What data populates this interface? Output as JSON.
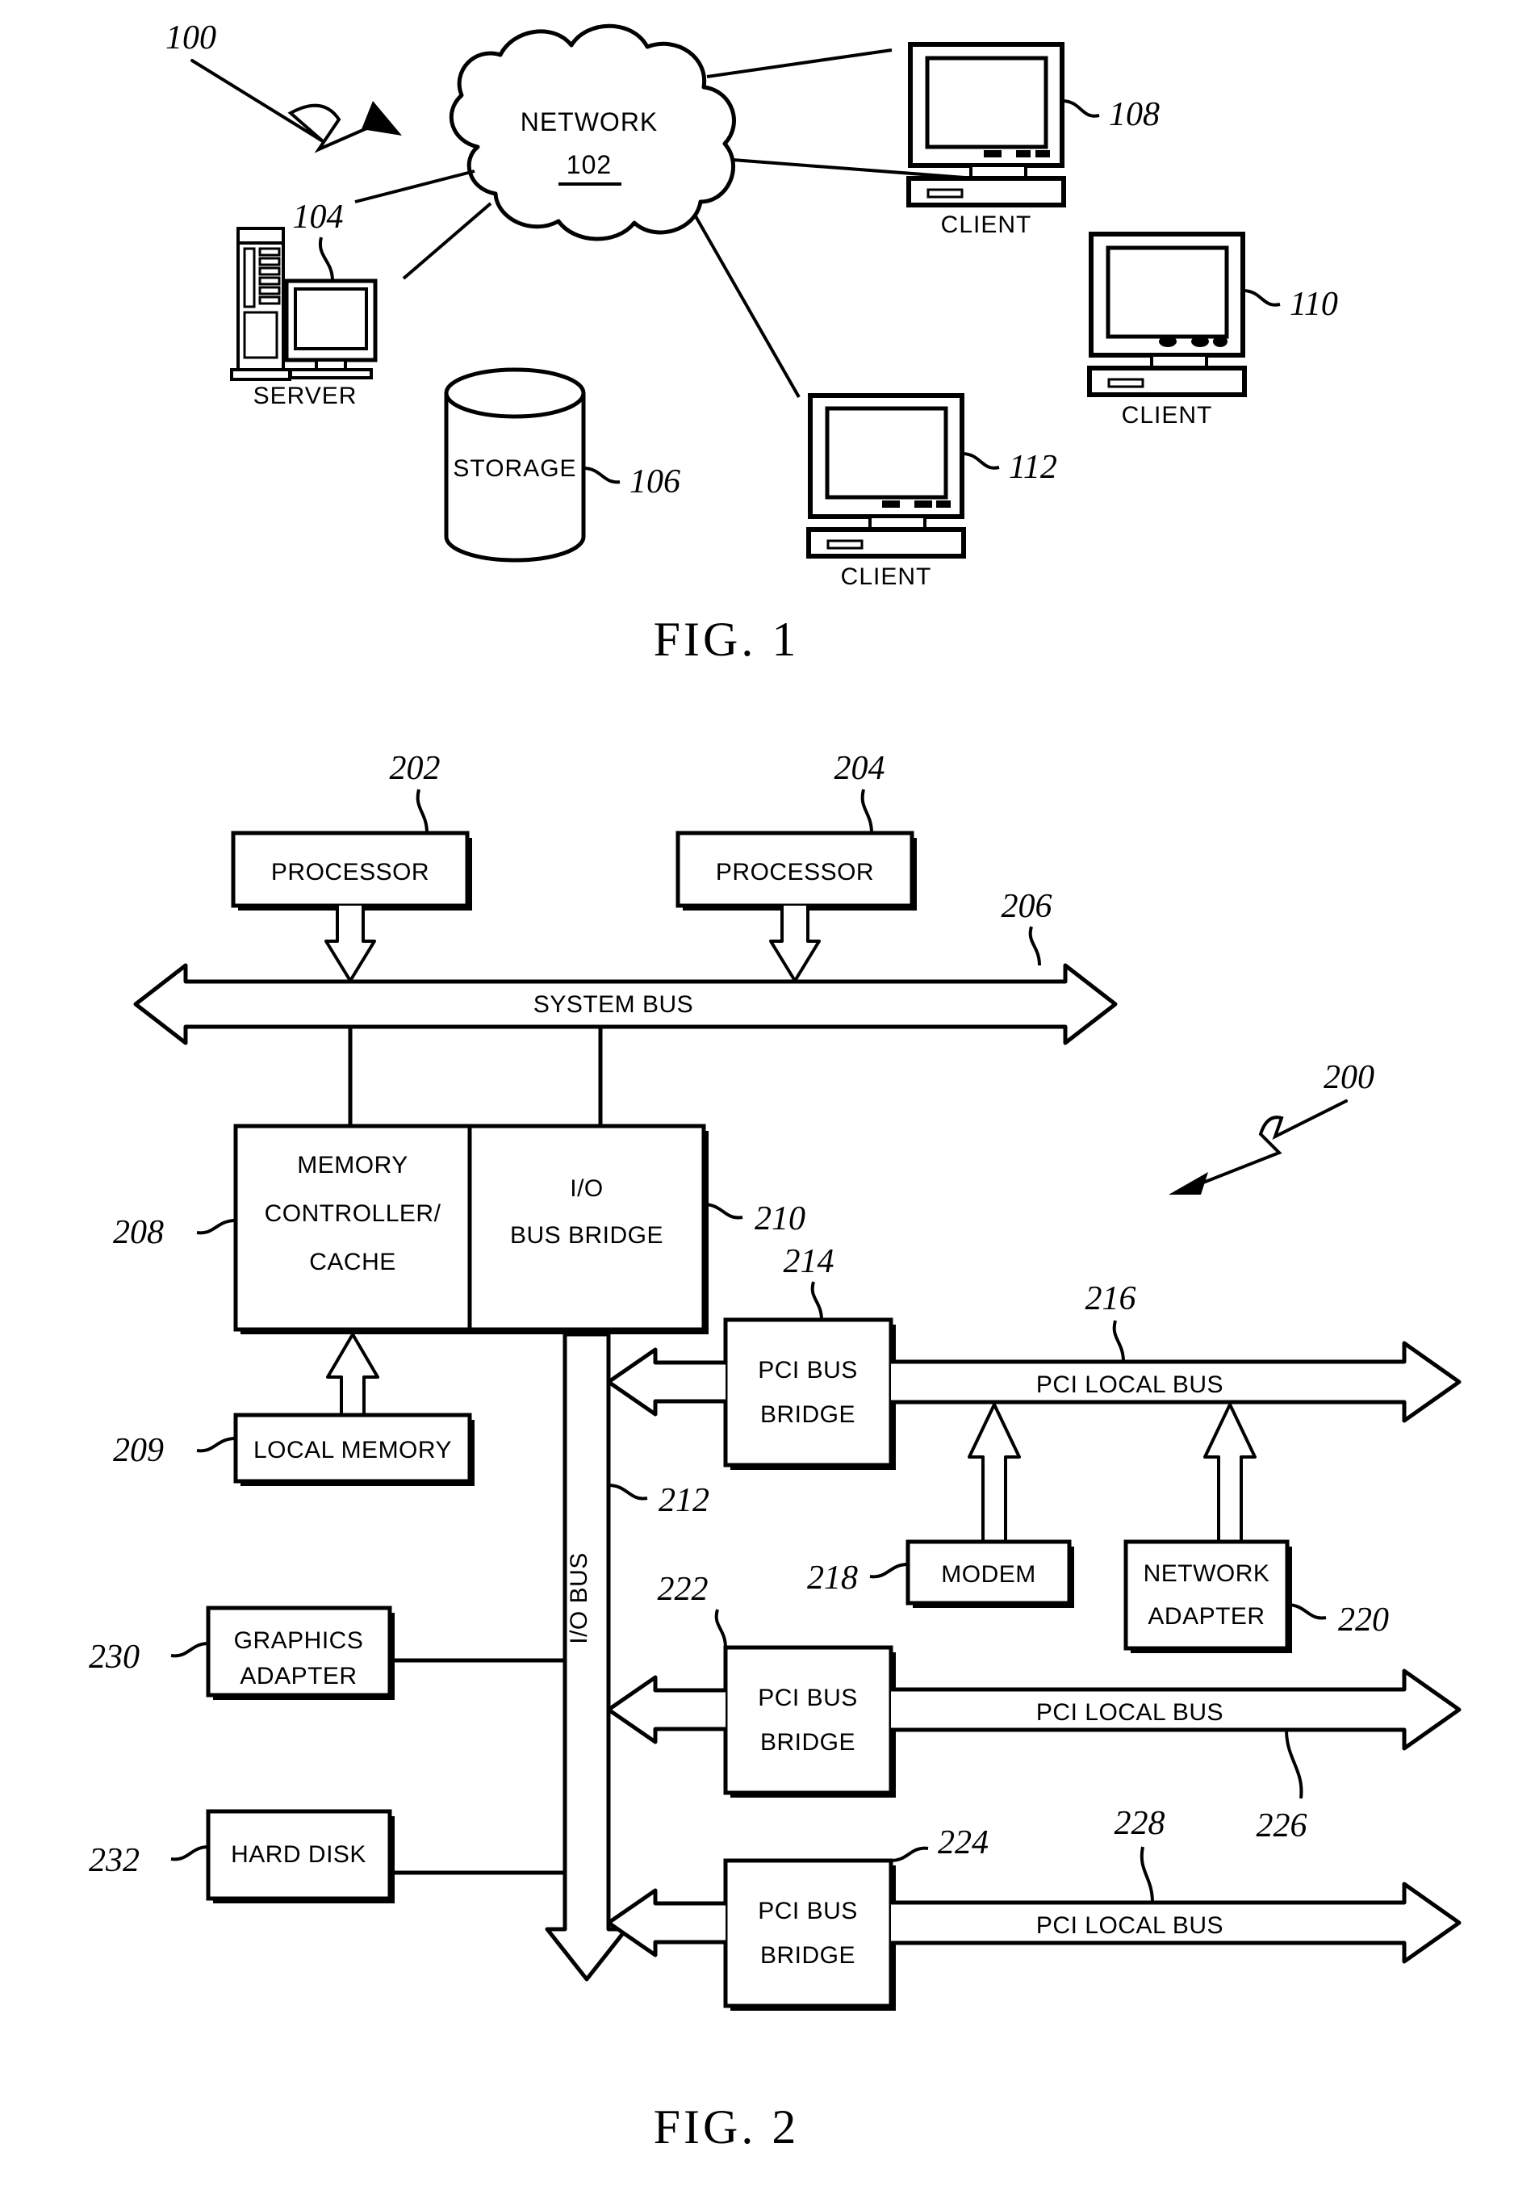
{
  "document": {
    "type": "patent-drawing-sheet",
    "figures": [
      "FIG. 1",
      "FIG. 2"
    ]
  },
  "fig1": {
    "caption": "FIG. 1",
    "system_ref": "100",
    "cloud": {
      "label": "NETWORK",
      "ref": "102"
    },
    "server": {
      "label": "SERVER",
      "ref": "104"
    },
    "storage": {
      "label": "STORAGE",
      "ref": "106"
    },
    "clients": [
      {
        "label": "CLIENT",
        "ref": "108"
      },
      {
        "label": "CLIENT",
        "ref": "110"
      },
      {
        "label": "CLIENT",
        "ref": "112"
      }
    ]
  },
  "fig2": {
    "caption": "FIG. 2",
    "system_ref": "200",
    "blocks": [
      {
        "id": "processor1",
        "label": "PROCESSOR",
        "ref": "202"
      },
      {
        "id": "processor2",
        "label": "PROCESSOR",
        "ref": "204"
      },
      {
        "id": "memory-controller",
        "line1": "MEMORY",
        "line2": "CONTROLLER/",
        "line3": "CACHE",
        "ref": "208"
      },
      {
        "id": "io-bus-bridge",
        "line1": "I/O",
        "line2": "BUS BRIDGE",
        "ref": "210"
      },
      {
        "id": "local-memory",
        "label": "LOCAL MEMORY",
        "ref": "209"
      },
      {
        "id": "pci-bus-bridge-1",
        "line1": "PCI BUS",
        "line2": "BRIDGE",
        "ref": "214"
      },
      {
        "id": "pci-bus-bridge-2",
        "line1": "PCI BUS",
        "line2": "BRIDGE",
        "ref": "222"
      },
      {
        "id": "pci-bus-bridge-3",
        "line1": "PCI BUS",
        "line2": "BRIDGE",
        "ref": "224"
      },
      {
        "id": "modem",
        "label": "MODEM",
        "ref": "218"
      },
      {
        "id": "network-adapter",
        "line1": "NETWORK",
        "line2": "ADAPTER",
        "ref": "220"
      },
      {
        "id": "graphics-adapter",
        "line1": "GRAPHICS",
        "line2": "ADAPTER",
        "ref": "230"
      },
      {
        "id": "hard-disk",
        "label": "HARD DISK",
        "ref": "232"
      }
    ],
    "buses": [
      {
        "id": "system-bus",
        "label": "SYSTEM BUS",
        "ref": "206"
      },
      {
        "id": "io-bus",
        "label": "I/O BUS",
        "ref": "212"
      },
      {
        "id": "pci-local-bus-1",
        "label": "PCI LOCAL BUS",
        "ref": "216"
      },
      {
        "id": "pci-local-bus-2",
        "label": "PCI LOCAL BUS",
        "ref": "226"
      },
      {
        "id": "pci-local-bus-3",
        "label": "PCI LOCAL BUS",
        "ref": "228"
      }
    ]
  },
  "colors": {
    "ink": "#000000",
    "paper": "#ffffff"
  }
}
